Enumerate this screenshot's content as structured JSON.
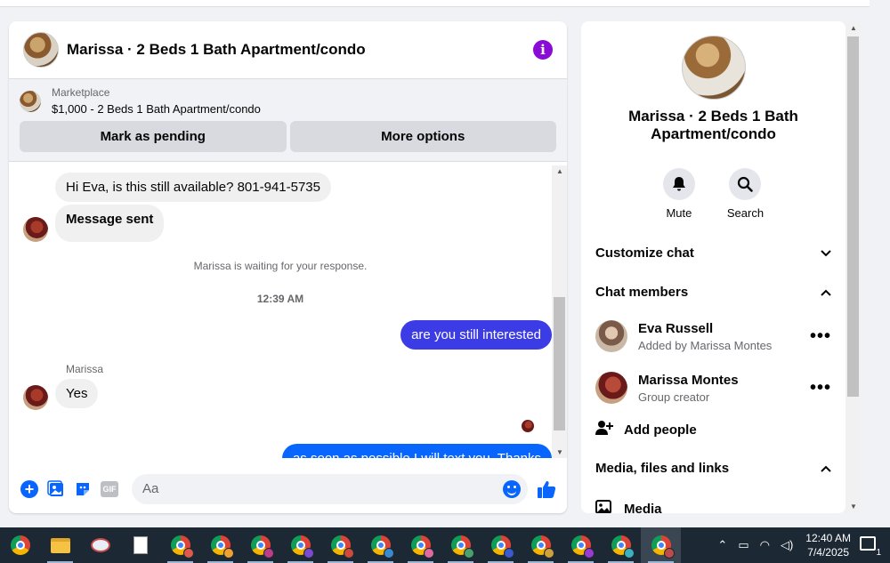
{
  "chat": {
    "title": "Marissa · 2 Beds 1 Bath Apartment/condo",
    "marketplace_label": "Marketplace",
    "listing": "$1,000 - 2 Beds 1 Bath Apartment/condo",
    "mark_pending": "Mark as pending",
    "more_options": "More options"
  },
  "messages": {
    "m1": "Hi Eva, is this still available? 801-941-5735",
    "m2": "Message sent",
    "waiting": "Marissa is waiting for your response.",
    "time": "12:39 AM",
    "m3": "are you still interested",
    "sender": "Marissa",
    "m4": "Yes",
    "m5": "as soon as possible I will text you. Thanks"
  },
  "composer": {
    "placeholder": "Aa"
  },
  "rpanel": {
    "title": "Marissa · 2 Beds 1 Bath Apartment/condo",
    "mute": "Mute",
    "search": "Search",
    "customize": "Customize chat",
    "members_header": "Chat members",
    "members": [
      {
        "name": "Eva Russell",
        "sub": "Added by Marissa Montes"
      },
      {
        "name": "Marissa Montes",
        "sub": "Group creator"
      }
    ],
    "add_people": "Add people",
    "media_header": "Media, files and links",
    "media": "Media"
  },
  "taskbar": {
    "time": "12:40 AM",
    "date": "7/4/2025",
    "notif_count": "1"
  },
  "colors": {
    "outgoing_purple": "#3c3ce6",
    "outgoing_blue": "#0866ff",
    "info_purple": "#8a0ad6"
  }
}
